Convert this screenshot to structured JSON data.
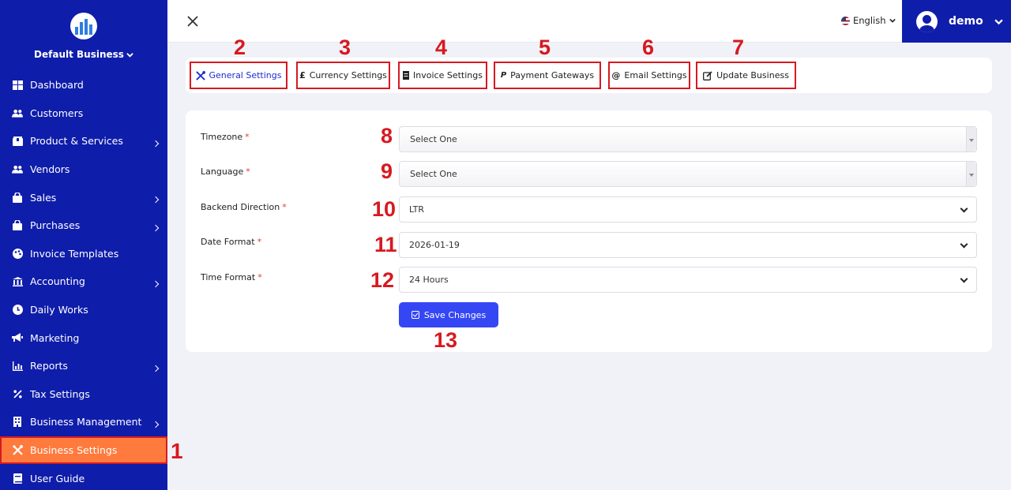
{
  "sidebar": {
    "business_name": "Default Business",
    "items": [
      {
        "label": "Dashboard",
        "icon": "dashboard-icon"
      },
      {
        "label": "Customers",
        "icon": "users-icon"
      },
      {
        "label": "Product & Services",
        "icon": "box-icon"
      },
      {
        "label": "Vendors",
        "icon": "users-icon"
      },
      {
        "label": "Sales",
        "icon": "shopping-bag-icon"
      },
      {
        "label": "Purchases",
        "icon": "shopping-bag-icon"
      },
      {
        "label": "Invoice Templates",
        "icon": "palette-icon"
      },
      {
        "label": "Accounting",
        "icon": "bank-icon"
      },
      {
        "label": "Daily Works",
        "icon": "clock-icon"
      },
      {
        "label": "Marketing",
        "icon": "megaphone-icon"
      },
      {
        "label": "Reports",
        "icon": "chart-icon"
      },
      {
        "label": "Tax Settings",
        "icon": "percent-icon"
      },
      {
        "label": "Business Management",
        "icon": "building-icon"
      },
      {
        "label": "Business Settings",
        "icon": "tools-icon"
      },
      {
        "label": "User Guide",
        "icon": "book-icon"
      }
    ],
    "marker": "1"
  },
  "topbar": {
    "language": "English",
    "username": "demo"
  },
  "tabs": [
    {
      "label": "General Settings",
      "marker": "2"
    },
    {
      "label": "Currency Settings",
      "marker": "3"
    },
    {
      "label": "Invoice Settings",
      "marker": "4"
    },
    {
      "label": "Payment Gateways",
      "marker": "5"
    },
    {
      "label": "Email Settings",
      "marker": "6"
    },
    {
      "label": "Update Business",
      "marker": "7"
    }
  ],
  "form": {
    "required_mark": "*",
    "fields": [
      {
        "label": "Timezone",
        "value": "Select One",
        "marker": "8"
      },
      {
        "label": "Language",
        "value": "Select One",
        "marker": "9"
      },
      {
        "label": "Backend Direction",
        "value": "LTR",
        "marker": "10"
      },
      {
        "label": "Date Format",
        "value": "2026-01-19",
        "marker": "11"
      },
      {
        "label": "Time Format",
        "value": "24 Hours",
        "marker": "12"
      }
    ],
    "save_label": "Save Changes",
    "save_marker": "13"
  },
  "colors": {
    "sidebar_bg": "#0f1dab",
    "active_item": "#ff7a3d",
    "annotation": "#d71920",
    "primary_button": "#3547f5"
  }
}
